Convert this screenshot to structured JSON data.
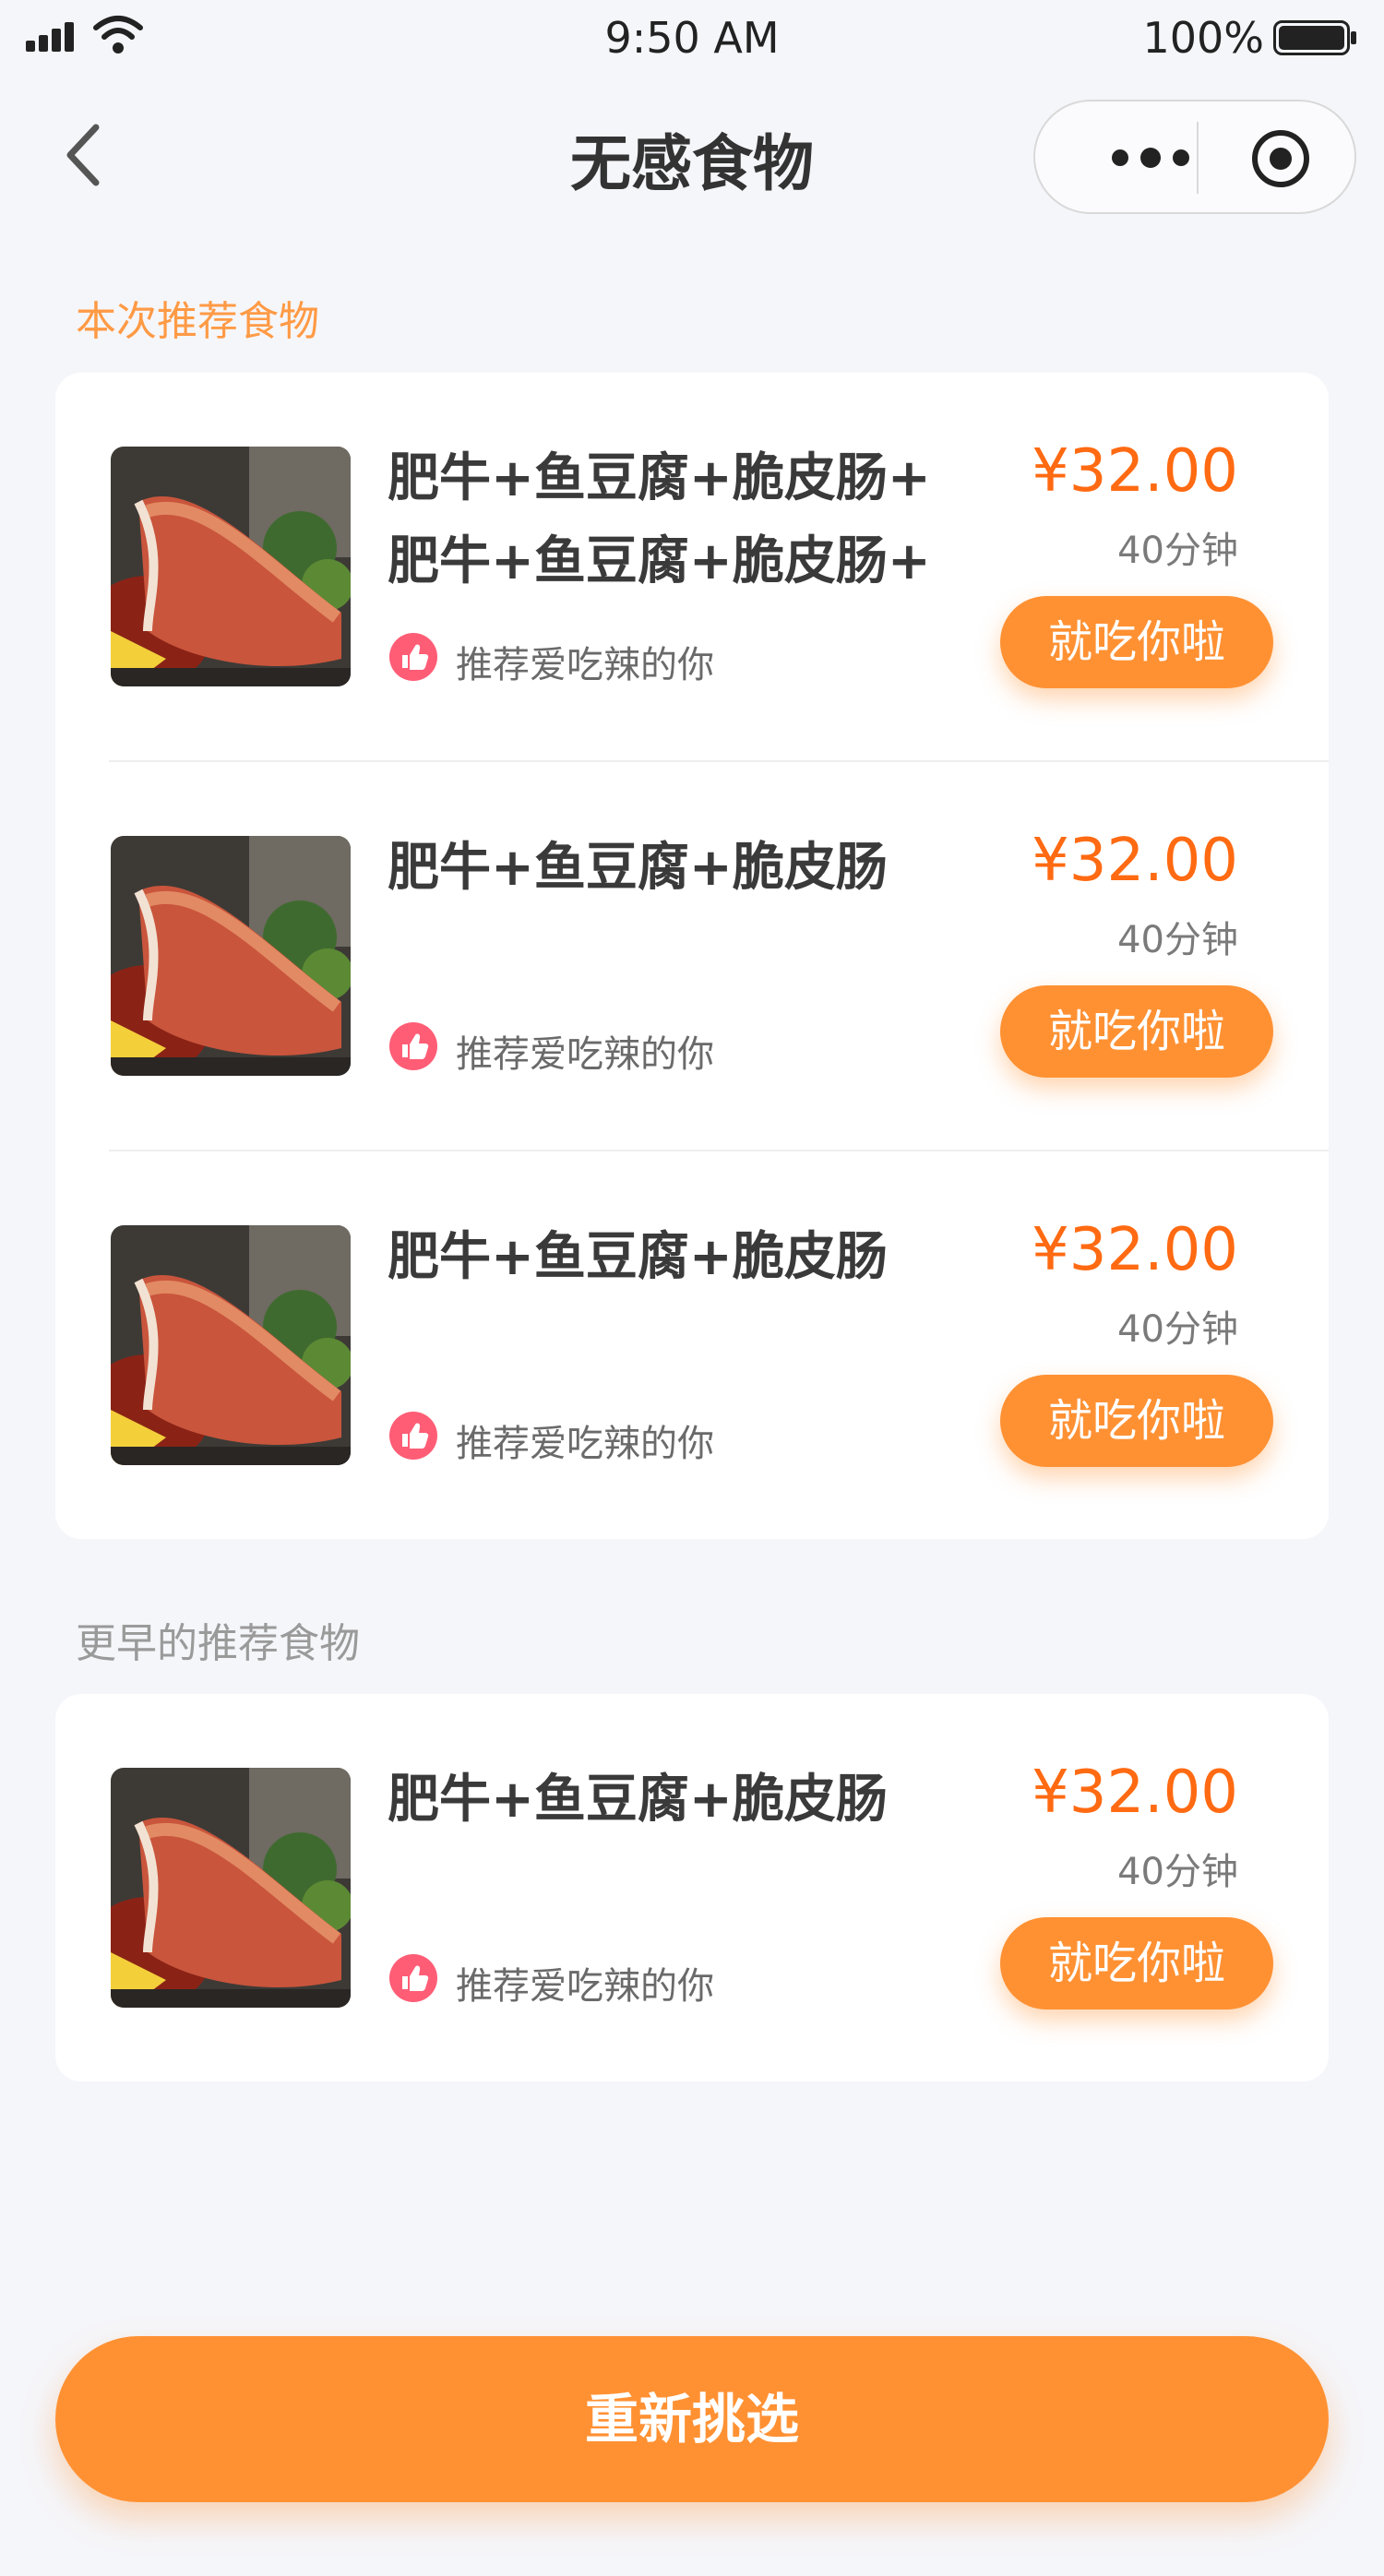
{
  "status_bar": {
    "time": "9:50 AM",
    "battery_percent": "100%"
  },
  "nav": {
    "title": "无感食物"
  },
  "sections": {
    "current_label": "本次推荐食物",
    "earlier_label": "更早的推荐食物"
  },
  "current_items": [
    {
      "name": "肥牛+鱼豆腐+脆皮肠+\n肥牛+鱼豆腐+脆皮肠+",
      "tag": "推荐爱吃辣的你",
      "price": "¥32.00",
      "duration": "40分钟",
      "button": "就吃你啦"
    },
    {
      "name": "肥牛+鱼豆腐+脆皮肠",
      "tag": "推荐爱吃辣的你",
      "price": "¥32.00",
      "duration": "40分钟",
      "button": "就吃你啦"
    },
    {
      "name": "肥牛+鱼豆腐+脆皮肠",
      "tag": "推荐爱吃辣的你",
      "price": "¥32.00",
      "duration": "40分钟",
      "button": "就吃你啦"
    }
  ],
  "earlier_items": [
    {
      "name": "肥牛+鱼豆腐+脆皮肠",
      "tag": "推荐爱吃辣的你",
      "price": "¥32.00",
      "duration": "40分钟",
      "button": "就吃你啦"
    }
  ],
  "footer": {
    "reselect_label": "重新挑选"
  },
  "colors": {
    "accent": "#ff9133",
    "price": "#ff6a12",
    "tag_icon": "#ff5d76",
    "section_current": "#ff9a45"
  },
  "icons": [
    "back-chevron-icon",
    "more-dots-icon",
    "close-target-icon",
    "thumbs-up-icon",
    "signal-icon",
    "wifi-icon",
    "battery-icon"
  ]
}
